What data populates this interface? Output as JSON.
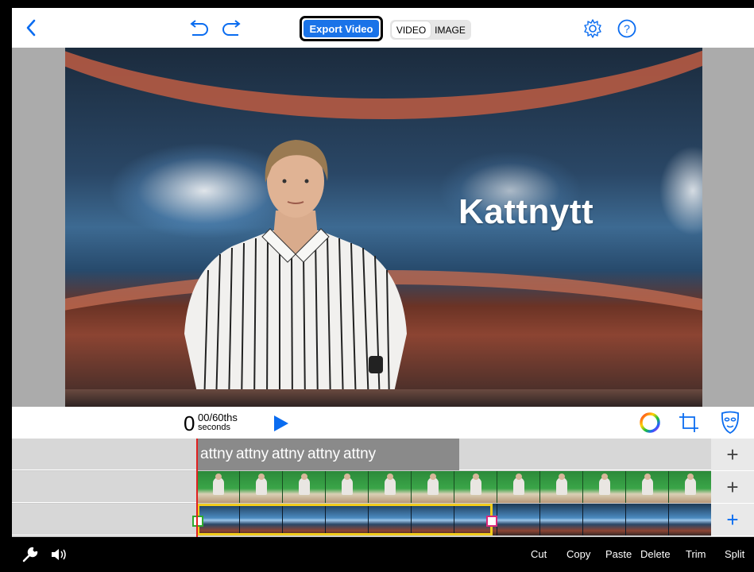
{
  "toolbar": {
    "export_label": "Export Video",
    "mode_video": "VIDEO",
    "mode_image": "IMAGE",
    "icons": [
      "back-chevron-icon",
      "undo-icon",
      "redo-icon",
      "settings-gear-icon",
      "help-icon"
    ]
  },
  "preview": {
    "title_text": "Kattnytt"
  },
  "playback": {
    "time_seconds": "0",
    "time_fraction": "00/60ths",
    "time_unit": "seconds"
  },
  "timeline": {
    "title_clip_text": "attny attny attny attny attny"
  },
  "actions": {
    "cut": "Cut",
    "copy": "Copy",
    "paste": "Paste",
    "delete": "Delete",
    "trim": "Trim",
    "split": "Split"
  },
  "colors": {
    "accent": "#1a73e8",
    "selection": "#f2cc1c",
    "playhead": "#e02020",
    "handle_start": "#2faa2f",
    "handle_end": "#d9287a"
  }
}
